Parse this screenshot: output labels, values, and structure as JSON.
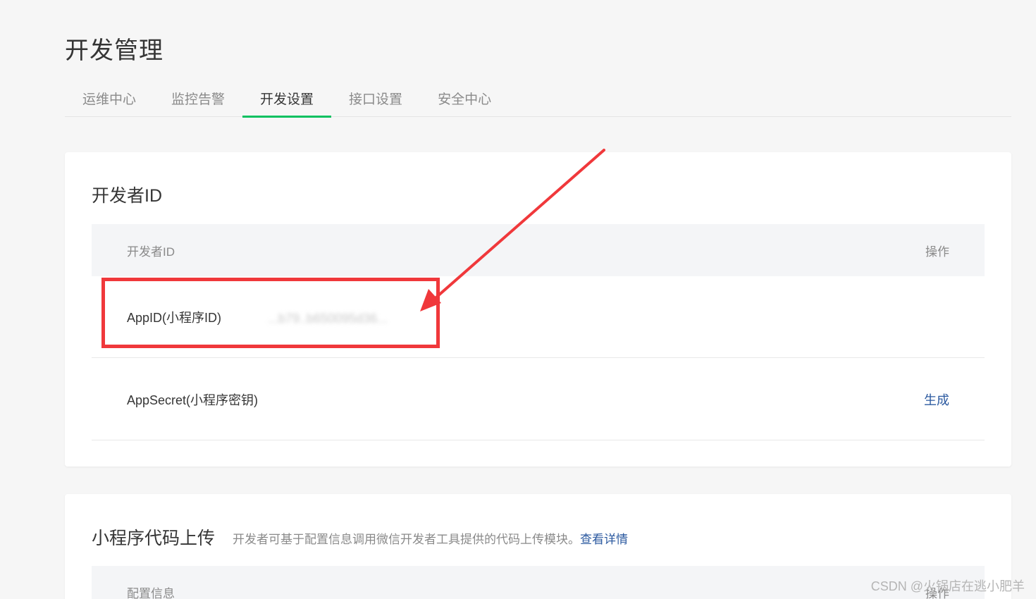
{
  "page": {
    "title": "开发管理"
  },
  "tabs": [
    {
      "label": "运维中心",
      "active": false
    },
    {
      "label": "监控告警",
      "active": false
    },
    {
      "label": "开发设置",
      "active": true
    },
    {
      "label": "接口设置",
      "active": false
    },
    {
      "label": "安全中心",
      "active": false
    }
  ],
  "developer_id": {
    "title": "开发者ID",
    "table_head": {
      "col_name": "开发者ID",
      "col_action": "操作"
    },
    "rows": [
      {
        "label": "AppID(小程序ID)",
        "value": "...b79..b650095d36...",
        "action": ""
      },
      {
        "label": "AppSecret(小程序密钥)",
        "value": "",
        "action": "生成"
      }
    ]
  },
  "code_upload": {
    "title": "小程序代码上传",
    "description": "开发者可基于配置信息调用微信开发者工具提供的代码上传模块。",
    "link": "查看详情",
    "table_head": {
      "col_name": "配置信息",
      "col_action": "操作"
    }
  },
  "annotation": {
    "color": "#f0383b"
  },
  "watermark": "CSDN @火锅店在逃小肥羊",
  "colors": {
    "accent": "#07c160",
    "link": "#2c5aa0"
  }
}
